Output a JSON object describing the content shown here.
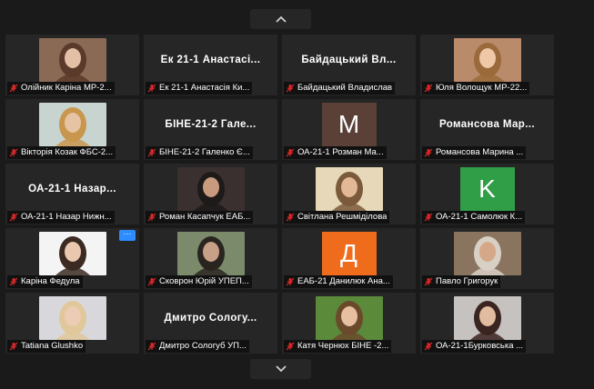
{
  "nav": {
    "up_icon": "chevron-up-icon",
    "down_icon": "chevron-down-icon"
  },
  "participants": [
    {
      "label": "Олійник Каріна МР-2...",
      "type": "video",
      "bg": "#8a6a55",
      "face": "#e2bfa5",
      "hair": "#5a3a2a"
    },
    {
      "label": "Ек 21-1 Анастасія Ки...",
      "type": "name",
      "display": "Ек 21-1 Анастасі..."
    },
    {
      "label": "Байдацький Владислав",
      "type": "name",
      "display": "Байдацький Вл..."
    },
    {
      "label": "Юля Волощук МР-22...",
      "type": "video",
      "bg": "#b98b6a",
      "face": "#efc8a8",
      "hair": "#9a6a3a"
    },
    {
      "label": "Вікторія Козак ФБС-2...",
      "type": "video",
      "bg": "#c8d4cf",
      "face": "#e6c3a3",
      "hair": "#c9964d"
    },
    {
      "label": "БІНЕ-21-2 Галенко Є...",
      "type": "name",
      "display": "БІНЕ-21-2 Гале..."
    },
    {
      "label": "ОА-21-1 Розман Ма...",
      "type": "avatar",
      "letter": "M",
      "color": "#5a4037"
    },
    {
      "label": "Романсова Марина ...",
      "type": "name",
      "display": "Романсова Мар..."
    },
    {
      "label": "ОА-21-1 Назар Нижн...",
      "type": "name",
      "display": "ОА-21-1 Назар..."
    },
    {
      "label": "Роман Касапчук ЕАБ...",
      "type": "video",
      "bg": "#3a3030",
      "face": "#c89a7e",
      "hair": "#1e1a1a"
    },
    {
      "label": "Світлана Решміділова",
      "type": "video",
      "bg": "#e6d8b8",
      "face": "#e2b896",
      "hair": "#7a5a3a"
    },
    {
      "label": "ОА-21-1 Самолюк К...",
      "type": "avatar",
      "letter": "K",
      "color": "#2f9e46"
    },
    {
      "label": "Каріна Федула",
      "type": "video",
      "bg": "#f4f4f4",
      "face": "#eac8b0",
      "hair": "#3a2a22",
      "more": "···"
    },
    {
      "label": "Сковрон Юрій УПЕП...",
      "type": "video",
      "bg": "#7a8a6a",
      "face": "#c8a088",
      "hair": "#2a2420"
    },
    {
      "label": "ЕАБ-21 Данилюк Ана...",
      "type": "avatar",
      "letter": "Д",
      "color": "#ef6c1d"
    },
    {
      "label": "Павло Григорук",
      "type": "video",
      "bg": "#8a7460",
      "face": "#d4a888",
      "hair": "#d8d0c4"
    },
    {
      "label": "Tatiana Glushko",
      "type": "video",
      "bg": "#d8d8dc",
      "face": "#ecccb4",
      "hair": "#e0c89a"
    },
    {
      "label": "Дмитро Сологуб УП...",
      "type": "name",
      "display": "Дмитро Сологу..."
    },
    {
      "label": "Катя Чернюх БІНЕ -2...",
      "type": "video",
      "bg": "#5a8a3a",
      "face": "#e6c0a0",
      "hair": "#6a4a2a"
    },
    {
      "label": "ОА-21-1Бурковська ...",
      "type": "video",
      "bg": "#c6c2c0",
      "face": "#e2bca0",
      "hair": "#3a2520"
    }
  ]
}
